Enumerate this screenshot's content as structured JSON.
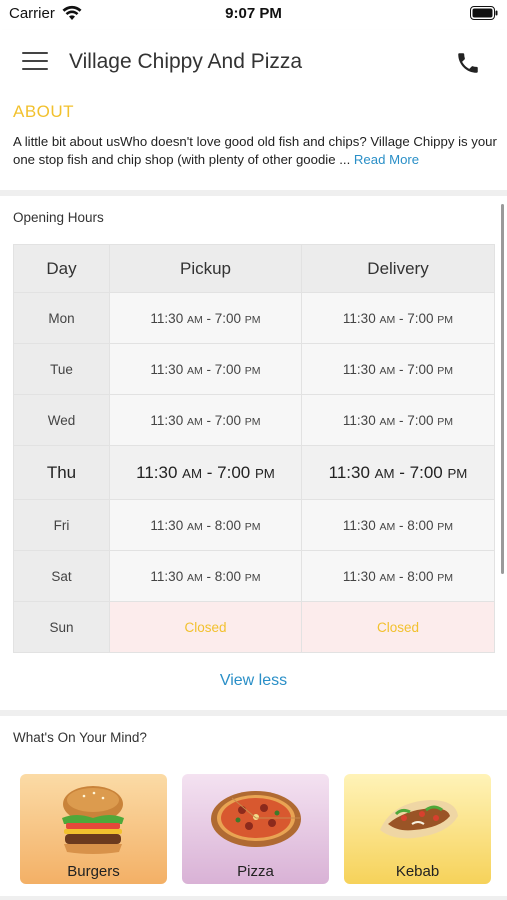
{
  "status_bar": {
    "carrier": "Carrier",
    "time": "9:07 PM"
  },
  "app_bar": {
    "title": "Village Chippy And Pizza",
    "menu_icon": "hamburger-menu-icon",
    "phone_icon": "phone-icon"
  },
  "about": {
    "heading": "ABOUT",
    "text": "A little bit about usWho doesn't love good old fish and chips? Village Chippy is your one stop fish and chip shop (with plenty of other goodie ...",
    "read_more": "Read More"
  },
  "opening_hours": {
    "title": "Opening Hours",
    "headers": [
      "Day",
      "Pickup",
      "Delivery"
    ],
    "rows": [
      {
        "day": "Mon",
        "pickup_open": "11:30",
        "pickup_close": "7:00",
        "delivery_open": "11:30",
        "delivery_close": "7:00"
      },
      {
        "day": "Tue",
        "pickup_open": "11:30",
        "pickup_close": "7:00",
        "delivery_open": "11:30",
        "delivery_close": "7:00"
      },
      {
        "day": "Wed",
        "pickup_open": "11:30",
        "pickup_close": "7:00",
        "delivery_open": "11:30",
        "delivery_close": "7:00"
      },
      {
        "day": "Thu",
        "pickup_open": "11:30",
        "pickup_close": "7:00",
        "delivery_open": "11:30",
        "delivery_close": "7:00"
      },
      {
        "day": "Fri",
        "pickup_open": "11:30",
        "pickup_close": "8:00",
        "delivery_open": "11:30",
        "delivery_close": "8:00"
      },
      {
        "day": "Sat",
        "pickup_open": "11:30",
        "pickup_close": "8:00",
        "delivery_open": "11:30",
        "delivery_close": "8:00"
      },
      {
        "day": "Sun",
        "pickup": "Closed",
        "delivery": "Closed"
      }
    ],
    "am": "AM",
    "pm": "PM",
    "view_less": "View less"
  },
  "whats_on_your_mind": {
    "title": "What's On Your Mind?",
    "categories": [
      {
        "label": "Burgers",
        "icon": "burger-image"
      },
      {
        "label": "Pizza",
        "icon": "pizza-image"
      },
      {
        "label": "Kebab",
        "icon": "kebab-image"
      }
    ]
  },
  "colors": {
    "accent": "#f2c12e",
    "link": "#2a8fc7",
    "closed_bg": "#fcecec"
  }
}
